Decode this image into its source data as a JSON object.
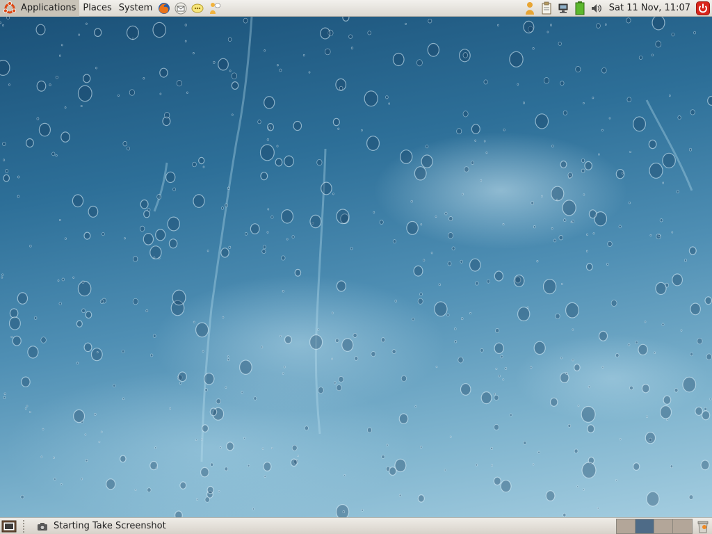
{
  "top_panel": {
    "menus": [
      {
        "label": "Applications"
      },
      {
        "label": "Places"
      },
      {
        "label": "System"
      }
    ],
    "launchers": [
      {
        "icon": "firefox-icon"
      },
      {
        "icon": "mail-icon"
      },
      {
        "icon": "chat-icon"
      },
      {
        "icon": "help-icon"
      }
    ],
    "tray": [
      {
        "icon": "user-switcher-icon"
      },
      {
        "icon": "clipboard-icon"
      },
      {
        "icon": "network-icon"
      },
      {
        "icon": "battery-icon"
      },
      {
        "icon": "volume-icon"
      }
    ],
    "clock": "Sat 11 Nov, 11:07",
    "logout_icon": "power-icon"
  },
  "bottom_panel": {
    "task": {
      "label": "Starting Take Screenshot",
      "icon": "camera-icon"
    },
    "workspaces": {
      "count": 4,
      "active_index": 1
    },
    "trash_icon": "trash-icon"
  },
  "colors": {
    "panel": "#dcd8d1",
    "workspace_active": "#4e6b87",
    "workspace_inactive": "#b3a699",
    "logout_red": "#d9261c"
  }
}
